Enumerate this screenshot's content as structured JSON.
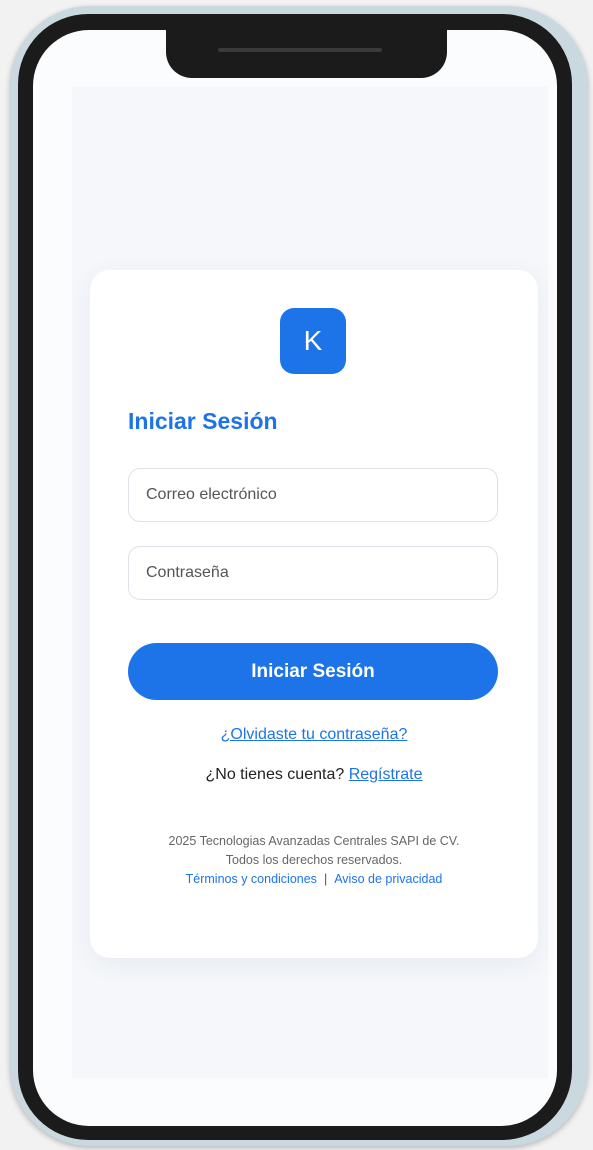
{
  "logo": {
    "letter": "K"
  },
  "login": {
    "title": "Iniciar Sesión",
    "email_placeholder": "Correo electrónico",
    "password_placeholder": "Contraseña",
    "submit_label": "Iniciar Sesión",
    "forgot_label": "¿Olvidaste tu contraseña?",
    "signup_prompt": "¿No tienes cuenta?",
    "signup_label": "Regístrate"
  },
  "footer": {
    "copyright": "2025 Tecnologias Avanzadas Centrales SAPI de CV.",
    "rights": "Todos los derechos reservados.",
    "terms_label": "Términos y condiciones",
    "separator": "|",
    "privacy_label": "Aviso de privacidad"
  },
  "colors": {
    "accent": "#1d74e8",
    "card_background": "#ffffff",
    "screen_background": "#f5f7fa"
  }
}
